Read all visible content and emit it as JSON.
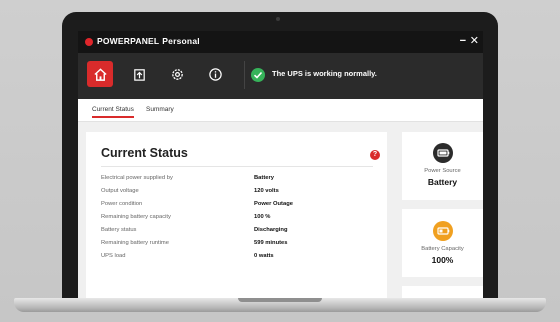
{
  "window": {
    "title_brand": "POWERPANEL",
    "title_edition": "Personal",
    "minimize": "−",
    "close": "✕"
  },
  "toolbar": {
    "buttons": [
      {
        "name": "home-button",
        "icon": "home-icon",
        "active": true
      },
      {
        "name": "export-button",
        "icon": "export-icon",
        "active": false
      },
      {
        "name": "settings-button",
        "icon": "gear-icon",
        "active": false
      },
      {
        "name": "info-button",
        "icon": "info-icon",
        "active": false
      }
    ],
    "status_message": "The UPS is working normally."
  },
  "tabs": [
    {
      "label": "Current Status",
      "active": true
    },
    {
      "label": "Summary",
      "active": false
    }
  ],
  "current_status": {
    "title": "Current Status",
    "rows": [
      {
        "label": "Electrical power supplied by",
        "value": "Battery"
      },
      {
        "label": "Output voltage",
        "value": "120 volts"
      },
      {
        "label": "Power condition",
        "value": "Power Outage"
      },
      {
        "label": "Remaining battery capacity",
        "value": "100 %"
      },
      {
        "label": "Battery status",
        "value": "Discharging"
      },
      {
        "label": "Remaining battery runtime",
        "value": "599 minutes"
      },
      {
        "label": "UPS load",
        "value": "0 watts"
      }
    ]
  },
  "cards": {
    "power_source": {
      "caption": "Power Source",
      "value": "Battery",
      "icon": "battery-icon"
    },
    "battery_capacity": {
      "caption": "Battery Capacity",
      "value": "100%",
      "icon": "battery-charge-icon"
    }
  },
  "colors": {
    "accent": "#d92b2b",
    "ok": "#36b35a",
    "orange": "#f0a020",
    "toolbar": "#2b2b2b",
    "titlebar": "#141414"
  }
}
